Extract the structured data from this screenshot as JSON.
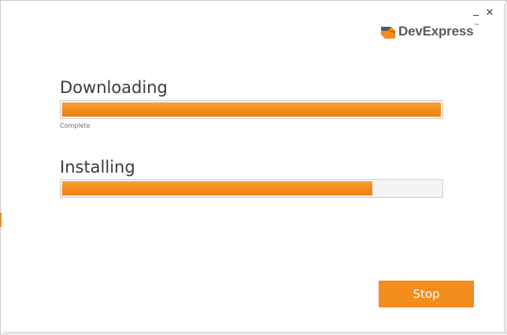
{
  "window": {
    "minimize_icon": "minimize-icon",
    "close_icon": "close-icon",
    "close_glyph": "✕"
  },
  "brand": {
    "name": "DevExpress",
    "trademark": "™",
    "logo_icon": "devexpress-logo-icon",
    "accent_color": "#f28c1c",
    "logo_dark_color": "#5a5a5a"
  },
  "downloading": {
    "title": "Downloading",
    "progress_percent": 100,
    "status": "Complete"
  },
  "installing": {
    "title": "Installing",
    "progress_percent": 82
  },
  "actions": {
    "stop_label": "Stop"
  }
}
